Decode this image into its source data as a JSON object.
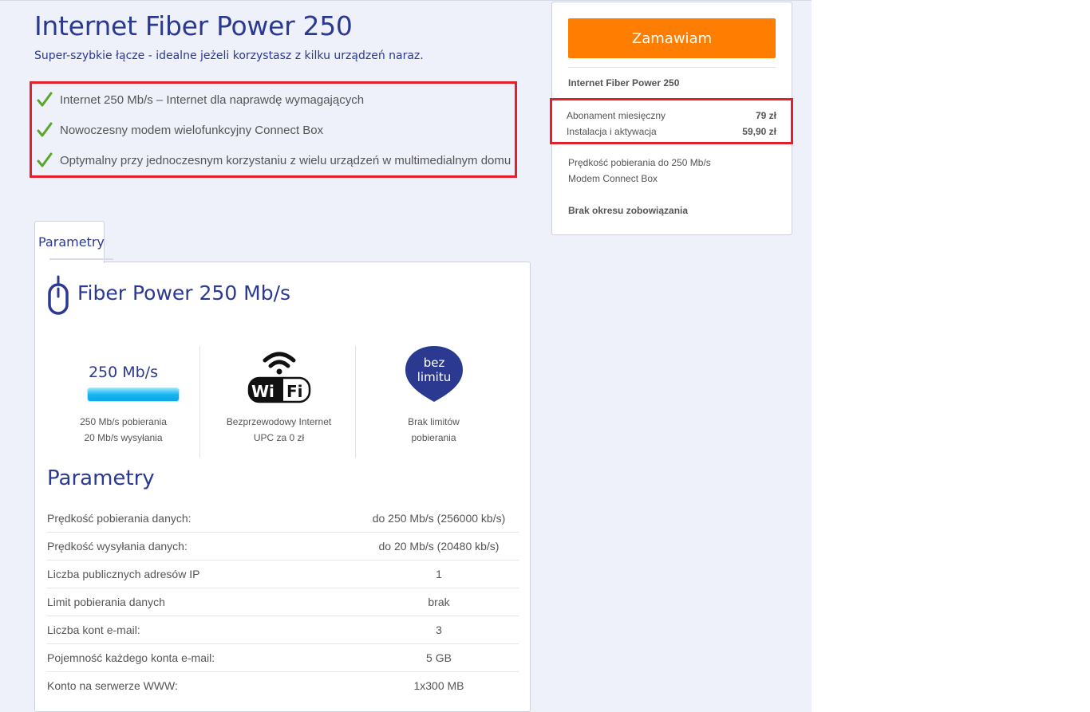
{
  "header": {
    "title": "Internet Fiber Power 250",
    "subtitle": "Super-szybkie łącze - idealne jeżeli korzystasz z kilku urządzeń naraz."
  },
  "features": [
    "Internet 250 Mb/s – Internet dla naprawdę wymagających",
    "Nowoczesny modem wielofunkcyjny Connect Box",
    "Optymalny przy jednoczesnym korzystaniu z wielu urządzeń w multimedialnym domu"
  ],
  "order": {
    "button_label": "Zamawiam",
    "plan_name": "Internet Fiber Power 250",
    "prices": [
      {
        "label": "Abonament miesięczny",
        "value": "79 zł"
      },
      {
        "label": "Instalacja i aktywacja",
        "value": "59,90 zł"
      }
    ],
    "details": [
      "Prędkość pobierania do 250 Mb/s",
      "Modem Connect Box"
    ],
    "commitment": "Brak okresu zobowiązania"
  },
  "tabs": [
    {
      "label": "Parametry",
      "active": true
    }
  ],
  "panel": {
    "title": "Fiber Power 250 Mb/s",
    "speed_label": "250 Mb/s",
    "speed_fill": 1.0,
    "columns": [
      {
        "line1": "250 Mb/s pobierania",
        "line2": "20 Mb/s wysyłania"
      },
      {
        "line1": "Bezprzewodowy Internet",
        "line2": "UPC za 0 zł",
        "icon_text": "Wi Fi"
      },
      {
        "line1": "Brak limitów",
        "line2": "pobierania",
        "badge_line1": "bez",
        "badge_line2": "limitu"
      }
    ],
    "params_title": "Parametry",
    "params": [
      {
        "label": "Prędkość pobierania danych:",
        "value": "do 250 Mb/s (256000 kb/s)"
      },
      {
        "label": "Prędkość wysyłania danych:",
        "value": "do 20 Mb/s (20480 kb/s)"
      },
      {
        "label": "Liczba publicznych adresów IP",
        "value": "1"
      },
      {
        "label": "Limit pobierania danych",
        "value": "brak"
      },
      {
        "label": "Liczba kont e-mail:",
        "value": "3"
      },
      {
        "label": "Pojemność każdego konta e-mail:",
        "value": "5 GB"
      },
      {
        "label": "Konto na serwerze WWW:",
        "value": "1x300 MB"
      }
    ]
  },
  "colors": {
    "brand_blue": "#2b3990",
    "accent_orange": "#ff7d00",
    "highlight_red": "#e2202b",
    "check_green": "#5aa72a",
    "speed_cyan": "#18b4f0"
  },
  "icons": [
    "check-icon",
    "mouse-icon",
    "wifi-icon",
    "bez-limitu-badge-icon"
  ]
}
